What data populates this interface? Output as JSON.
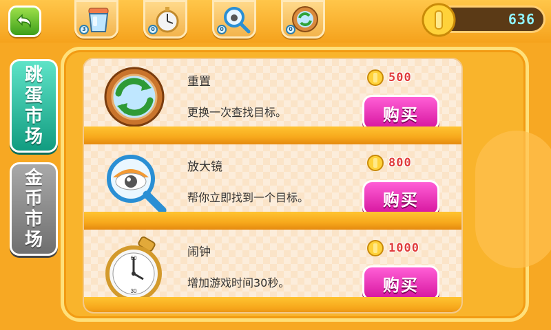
{
  "topbar": {
    "back_icon": "back-arrow-icon",
    "slots": [
      {
        "icon": "bucket-icon",
        "count": "3"
      },
      {
        "icon": "stopwatch-icon",
        "count": "0"
      },
      {
        "icon": "magnifier-eye-icon",
        "count": "0"
      },
      {
        "icon": "refresh-icon",
        "count": "0"
      }
    ],
    "coins": "636"
  },
  "tabs": [
    {
      "label": "跳蛋市场",
      "active": true
    },
    {
      "label": "金币市场",
      "active": false
    }
  ],
  "items": [
    {
      "name": "重置",
      "desc": "更换一次查找目标。",
      "price": "500",
      "buy": "购买",
      "icon": "refresh-icon"
    },
    {
      "name": "放大镜",
      "desc": "帮你立即找到一个目标。",
      "price": "800",
      "buy": "购买",
      "icon": "magnifier-eye-icon"
    },
    {
      "name": "闹钟",
      "desc": "增加游戏时间30秒。",
      "price": "1000",
      "buy": "购买",
      "icon": "stopwatch-icon"
    }
  ],
  "colors": {
    "accent": "#f7a823",
    "buy": "#e62fb5",
    "tab_active": "#2cc3a5",
    "tab_inactive": "#8a8a8a"
  }
}
